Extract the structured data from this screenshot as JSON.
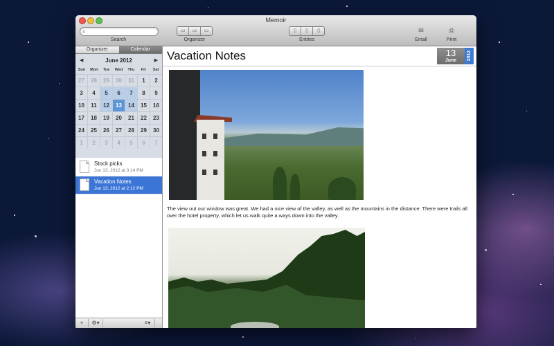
{
  "window": {
    "title": "Memoir"
  },
  "toolbar": {
    "search_label": "Search",
    "search_placeholder": "",
    "organizer_label": "Organizer",
    "entries_label": "Entries",
    "email_label": "Email",
    "print_label": "Print"
  },
  "sidebar": {
    "tabs": [
      {
        "label": "Organizer",
        "active": false
      },
      {
        "label": "Calendar",
        "active": true
      }
    ],
    "calendar": {
      "month_label": "June 2012",
      "prev": "◀",
      "next": "▶",
      "dow": [
        "Sun",
        "Mon",
        "Tue",
        "Wed",
        "Thu",
        "Fri",
        "Sat"
      ],
      "weeks": [
        [
          "27",
          "28",
          "29",
          "30",
          "31",
          "1",
          "2"
        ],
        [
          "3",
          "4",
          "5",
          "6",
          "7",
          "8",
          "9"
        ],
        [
          "10",
          "11",
          "12",
          "13",
          "14",
          "15",
          "16"
        ],
        [
          "17",
          "18",
          "19",
          "20",
          "21",
          "22",
          "23"
        ],
        [
          "24",
          "25",
          "26",
          "27",
          "28",
          "29",
          "30"
        ],
        [
          "1",
          "2",
          "3",
          "4",
          "5",
          "6",
          "7"
        ]
      ],
      "selected_day": "13"
    },
    "entries": [
      {
        "title": "Stock picks",
        "date": "Jun 13, 2012 at 3:14 PM",
        "selected": false
      },
      {
        "title": "Vacation Notes",
        "date": "Jun 13, 2012 at 2:12 PM",
        "selected": true
      }
    ],
    "bottom": {
      "add": "+",
      "gear": "⚙▾",
      "list": "≡▾"
    }
  },
  "content": {
    "title": "Vacation Notes",
    "date_day": "13",
    "date_month": "June",
    "date_year": "2012",
    "caption": "The view out our window was great. We had a nice view of the valley, as well as the mountains in the distance. There were trails all over the hotel property, which let us walk quite a ways down into the valley."
  },
  "colors": {
    "accent": "#3b76d6",
    "calendar_bg": "#d8dde5",
    "selected_day": "#5c95d8"
  },
  "icons": {
    "search": "search-icon",
    "email": "envelope-icon",
    "print": "printer-icon"
  }
}
